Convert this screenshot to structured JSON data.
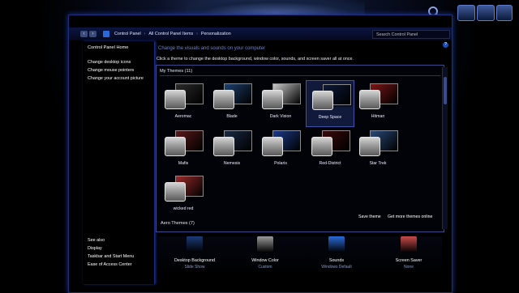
{
  "nav": {
    "crumbs": [
      "Control Panel",
      "All Control Panel Items",
      "Personalization"
    ],
    "search_placeholder": "Search Control Panel"
  },
  "sidebar": {
    "home": "Control Panel Home",
    "links": [
      "Change desktop icons",
      "Change mouse pointers",
      "Change your account picture"
    ],
    "see_also_title": "See also",
    "see_also": [
      "Display",
      "Taskbar and Start Menu",
      "Ease of Access Center"
    ]
  },
  "main": {
    "heading": "Change the visuals and sounds on your computer",
    "description": "Click a theme to change the desktop background, window color, sounds, and screen saver all at once.",
    "my_themes_label": "My Themes (11)",
    "themes": [
      {
        "name": "Aeromac",
        "selected": false,
        "color": "#2b2b2b"
      },
      {
        "name": "Blade",
        "selected": false,
        "color": "#1d3f6e"
      },
      {
        "name": "Dark Vision",
        "selected": false,
        "color": "#c9c9c9"
      },
      {
        "name": "Deep Space",
        "selected": true,
        "color": "#0e1a3a"
      },
      {
        "name": "Hitman",
        "selected": false,
        "color": "#7a1616"
      },
      {
        "name": "Mafis",
        "selected": false,
        "color": "#5a1a1a"
      },
      {
        "name": "Nemesis",
        "selected": false,
        "color": "#1a2a44"
      },
      {
        "name": "Polaris",
        "selected": false,
        "color": "#1b3b8a"
      },
      {
        "name": "Red-District",
        "selected": false,
        "color": "#3a0a0a"
      },
      {
        "name": "Star Trek",
        "selected": false,
        "color": "#2a4a7a"
      },
      {
        "name": "wicked red",
        "selected": false,
        "color": "#9a2a2a"
      }
    ],
    "save_theme": "Save theme",
    "get_more": "Get more themes online",
    "aero_themes_label": "Aero Themes (7)"
  },
  "bottom": [
    {
      "title": "Desktop Background",
      "subtitle": "Slide Show",
      "color": "#1c3a7a"
    },
    {
      "title": "Window Color",
      "subtitle": "Custom",
      "color": "#9a9a9a"
    },
    {
      "title": "Sounds",
      "subtitle": "Windows Default",
      "color": "#2a6ad8"
    },
    {
      "title": "Screen Saver",
      "subtitle": "None",
      "color": "#c94a4a"
    }
  ]
}
